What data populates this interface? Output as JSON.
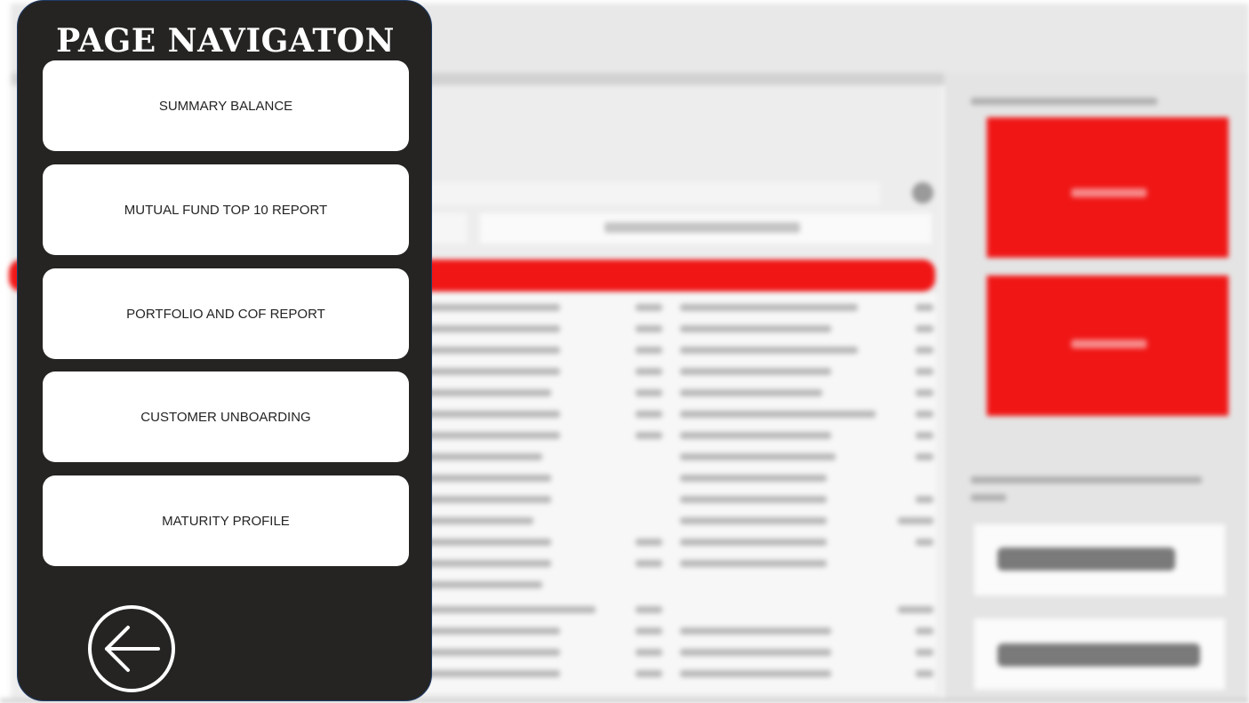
{
  "nav": {
    "title": "PAGE NAVIGATON",
    "buttons": [
      {
        "label": "SUMMARY BALANCE"
      },
      {
        "label": "MUTUAL FUND TOP 10 REPORT"
      },
      {
        "label": "PORTFOLIO AND COF REPORT"
      },
      {
        "label": "CUSTOMER UNBOARDING"
      },
      {
        "label": "MATURITY PROFILE"
      }
    ],
    "back_icon": "back-arrow-circle-icon"
  },
  "colors": {
    "panel_bg": "#252423",
    "button_bg": "#ffffff",
    "accent_red": "#f01616"
  }
}
